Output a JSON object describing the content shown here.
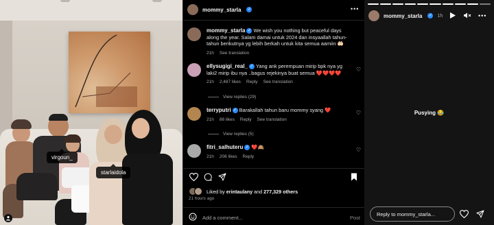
{
  "photo": {
    "tags": [
      "virgoun_",
      "starlaidola"
    ],
    "user_tags_icon": "person-icon"
  },
  "post": {
    "author": "mommy_starla",
    "more_label": "•••",
    "caption": {
      "username": "mommy_starla",
      "text": "We wish you nothing but peaceful days along the year. Salam damai untuk 2024 dan insyaallah tahun-tahun berikutnya yg lebih berkah untuk kita semua aamiin 🤲🏻",
      "time": "21h",
      "see_translation": "See translation"
    },
    "comments": [
      {
        "username": "ellysugigi_real_",
        "text": "Yang ank perempuan mirip bpk nya yg laki2 mirip ibu nya ..bagus rejekinya buat semua ❤️❤️❤️❤️",
        "time": "21h",
        "likes": "2,487 likes",
        "reply": "Reply",
        "see_translation": "See translation",
        "view_replies": "View replies (29)"
      },
      {
        "username": "terryputri",
        "text": "Barakallah tahun baru mommy syang ❤️",
        "time": "21h",
        "likes": "86 likes",
        "reply": "Reply",
        "see_translation": "See translation",
        "view_replies": "View replies (5)"
      },
      {
        "username": "fitri_salhuteru",
        "text": "❤️🙈",
        "time": "21h",
        "likes": "206 likes",
        "reply": "Reply"
      }
    ],
    "likes_line": {
      "prefix": "Liked by ",
      "user": "erintaulany",
      "middle": " and ",
      "count": "277,329 others"
    },
    "timestamp": "21 hours ago",
    "add_comment_placeholder": "Add a comment...",
    "post_button": "Post"
  },
  "story": {
    "username": "mommy_starla",
    "ago": "1h",
    "caption": "Pusying 😂",
    "reply_placeholder": "Reply to mommy_starla...",
    "progress_total": 10,
    "progress_done": 9
  },
  "colors": {
    "background": "#000000",
    "story_bg": "#141414",
    "verified": "#2a8cff",
    "muted_text": "#a8a8a8",
    "heart": "#ed4956"
  }
}
